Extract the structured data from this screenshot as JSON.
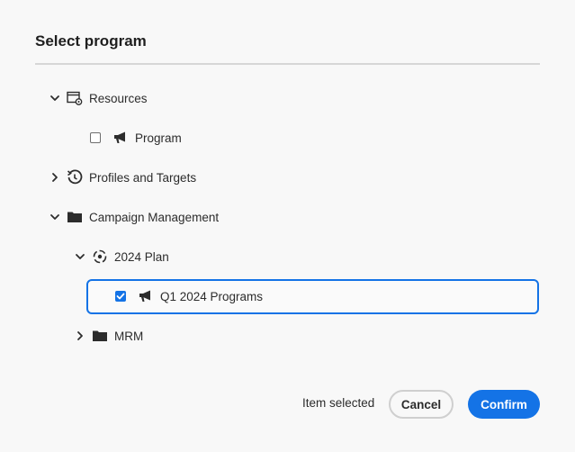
{
  "dialog": {
    "title": "Select program"
  },
  "tree": {
    "resources": {
      "label": "Resources",
      "expanded": true,
      "icon": "resources-settings-icon"
    },
    "program": {
      "label": "Program",
      "checked": false,
      "icon": "megaphone-icon"
    },
    "profiles": {
      "label": "Profiles and Targets",
      "expanded": false,
      "icon": "history-refresh-icon"
    },
    "campaign": {
      "label": "Campaign Management",
      "expanded": true,
      "icon": "folder-icon"
    },
    "plan2024": {
      "label": "2024 Plan",
      "expanded": true,
      "icon": "target-plan-icon"
    },
    "q1programs": {
      "label": "Q1 2024 Programs",
      "checked": true,
      "icon": "megaphone-icon"
    },
    "mrm": {
      "label": "MRM",
      "expanded": false,
      "icon": "folder-icon"
    }
  },
  "footer": {
    "status": "Item selected",
    "cancel_label": "Cancel",
    "confirm_label": "Confirm"
  },
  "colors": {
    "accent": "#1473e6",
    "background": "#f8f8f8"
  }
}
